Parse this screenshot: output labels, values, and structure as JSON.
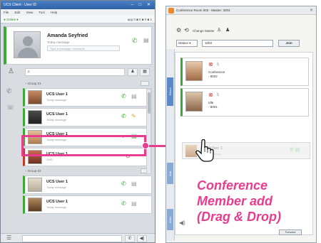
{
  "left_window": {
    "title": "UCS Client - User ID",
    "menu": [
      "File",
      "Edit",
      "View",
      "Tool",
      "Help"
    ],
    "status": "Online",
    "stats": "app 0  ■ 0  ■ 0  ■ 1",
    "profile": {
      "name": "Amanda Seyfried",
      "status_text": "Today message",
      "input_placeholder": "Type a message / schedule..."
    },
    "groups": [
      {
        "name": "Group 01",
        "contacts": [
          {
            "name": "UCS User 1",
            "status": "Today message",
            "state": "online",
            "avatar": "ava-a"
          },
          {
            "name": "UCS User 1",
            "status": "Today message",
            "state": "online",
            "avatar": "ava-b"
          },
          {
            "name": "UCS User 1",
            "status": "Today message",
            "state": "online",
            "avatar": "ava-c"
          },
          {
            "name": "UCS User 1",
            "status": "DND",
            "state": "dnd",
            "avatar": "ava-d"
          }
        ]
      },
      {
        "name": "Group 02",
        "contacts": [
          {
            "name": "UCS User 1",
            "status": "Today message",
            "state": "online",
            "avatar": "ava-e"
          },
          {
            "name": "UCS User 1",
            "status": "Today message",
            "state": "online",
            "avatar": "ava-f"
          }
        ]
      }
    ]
  },
  "right_window": {
    "title": "Conference Room 003 - Master: 3003",
    "toolbar_label": "Change Master",
    "filter_select": "Station",
    "filter_number": "1003",
    "join_label": "Join",
    "members": [
      {
        "label": "Conference\n- 8002"
      },
      {
        "label": "Idle\n- 8001"
      }
    ],
    "ghost_name": "UCS User 1",
    "ghost_status": "Today message",
    "side_tabs": [
      "Room",
      "Add",
      "Invite"
    ],
    "forward_label": "Forward"
  },
  "caption": {
    "line1": "Conference",
    "line2": "Member add",
    "line3": "(Drag & Drop)"
  },
  "colors": {
    "accent": "#e83d8f",
    "online": "#3aaa35",
    "dnd": "#d93030"
  }
}
